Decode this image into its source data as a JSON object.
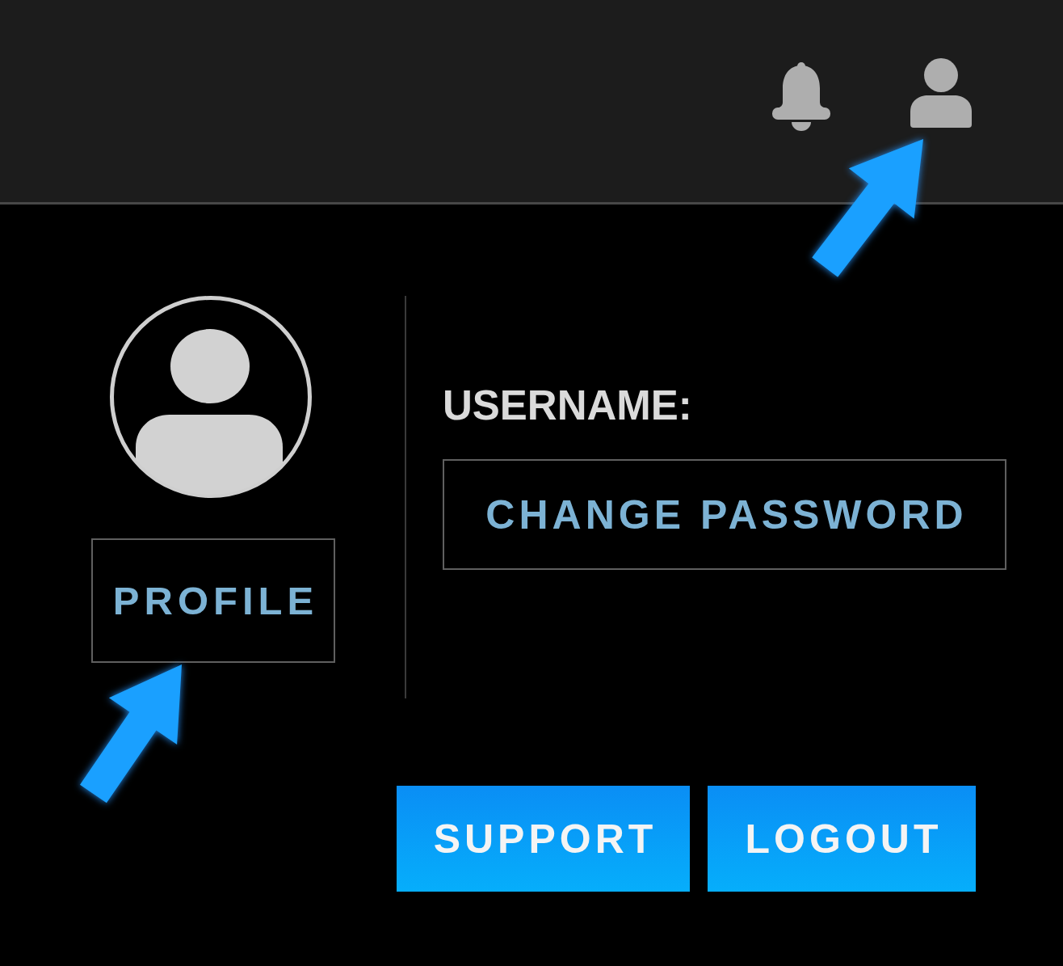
{
  "profile_panel": {
    "profile_button": "PROFILE"
  },
  "account_panel": {
    "username_label": "USERNAME:",
    "change_password_button": "CHANGE PASSWORD"
  },
  "actions": [
    {
      "label": "SUPPORT"
    },
    {
      "label": "LOGOUT"
    }
  ]
}
